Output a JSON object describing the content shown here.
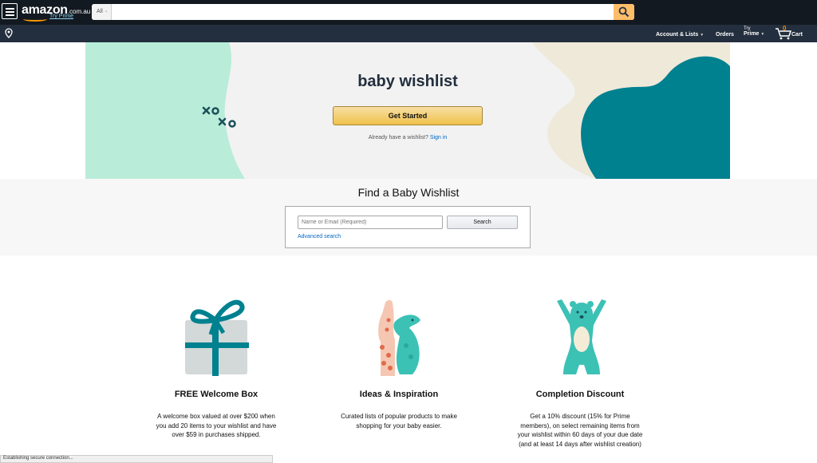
{
  "nav": {
    "logo_wordmark": "amazon",
    "logo_tld": ".com.au",
    "try_prime": "Try Prime",
    "search_category": "All",
    "account_lists": "Account & Lists",
    "orders": "Orders",
    "try_label": "Try",
    "prime": "Prime",
    "cart_count": "0",
    "cart": "Cart"
  },
  "hero": {
    "title": "baby wishlist",
    "cta": "Get Started",
    "already_text": "Already have a wishlist?",
    "sign_in": "Sign in",
    "colors": {
      "mint": "#b9ecd9",
      "cream": "#f0eadb",
      "teal": "#00818f",
      "button": "#f0c14b"
    }
  },
  "find": {
    "title": "Find a Baby Wishlist",
    "input_placeholder": "Name or Email (Required)",
    "search_button": "Search",
    "advanced": "Advanced search"
  },
  "features": [
    {
      "icon": "gift-box-icon",
      "title": "FREE Welcome Box",
      "text": "A welcome box valued at over $200 when you add 20 items to your wishlist and have over $59 in purchases shipped."
    },
    {
      "icon": "giraffe-kangaroo-icon",
      "title": "Ideas & Inspiration",
      "text": "Curated lists of popular products to make shopping for your baby easier."
    },
    {
      "icon": "bear-icon",
      "title": "Completion Discount",
      "text": "Get a 10% discount (15% for Prime members), on select remaining items from your wishlist within 60 days of your due date (and at least 14 days after wishlist creation)"
    }
  ],
  "status_bar": "Establishing secure connection..."
}
